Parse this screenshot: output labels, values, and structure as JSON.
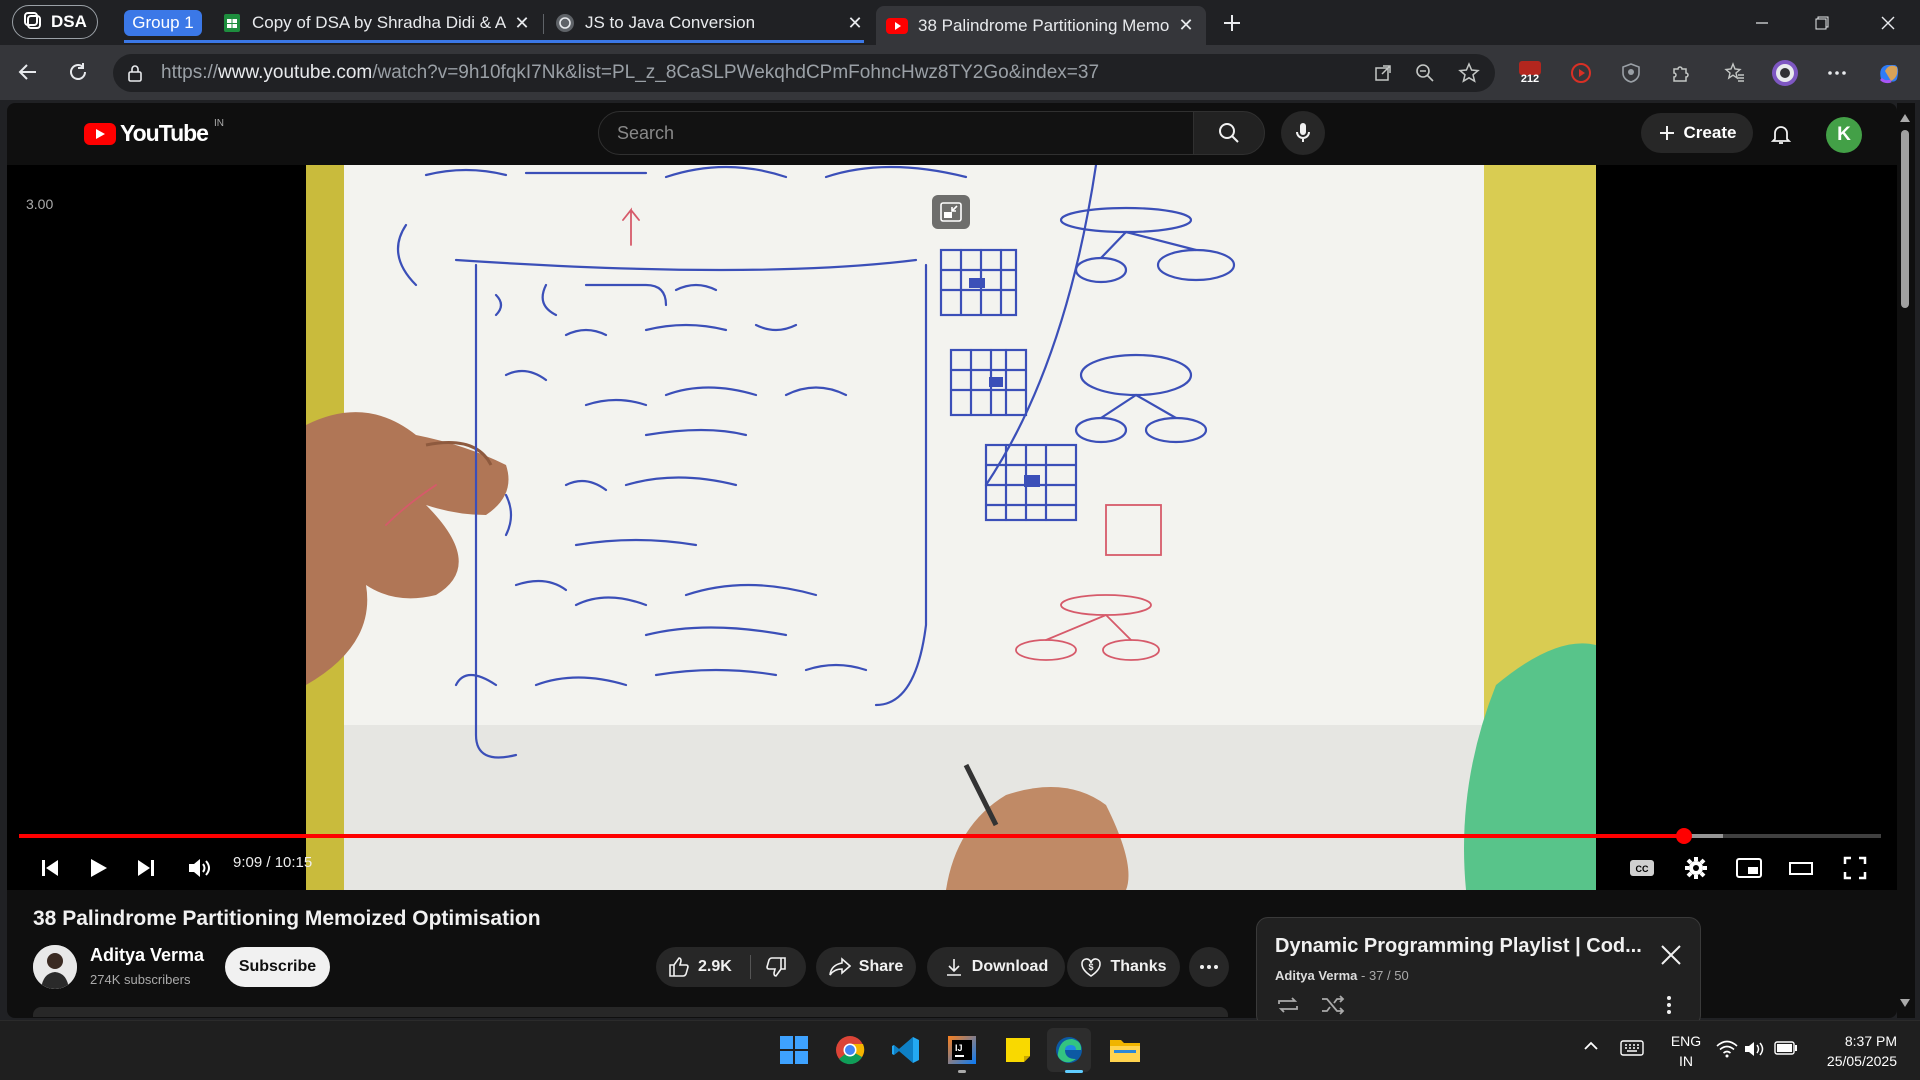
{
  "browser": {
    "profile_label": "DSA",
    "group_label": "Group 1",
    "tabs": [
      {
        "title": "Copy of DSA by Shradha Didi & A",
        "icon": "google-sheets-icon"
      },
      {
        "title": "JS to Java Conversion",
        "icon": "chatgpt-icon"
      },
      {
        "title": "38 Palindrome Partitioning Memo",
        "icon": "youtube-icon",
        "active": true
      }
    ],
    "url_prefix": "https://",
    "url_domain": "www.youtube.com",
    "url_path": "/watch?v=9h10fqkI7Nk&list=PL_z_8CaSLPWekqhdCPmFohncHwz8TY2Go&index=37",
    "extension_badge": "212"
  },
  "youtube": {
    "wordmark": "YouTube",
    "region": "IN",
    "search_placeholder": "Search",
    "create_label": "Create",
    "avatar_letter": "K",
    "player": {
      "speed_label": "3.00",
      "time_current": "9:09",
      "time_total": "10:15",
      "time_display": "9:09 / 10:15",
      "progress_fraction": 0.894,
      "buffered_fraction": 0.915
    },
    "video": {
      "title": "38 Palindrome Partitioning Memoized Optimisation",
      "channel_name": "Aditya Verma",
      "subscribers": "274K subscribers",
      "subscribe_label": "Subscribe",
      "likes": "2.9K",
      "share_label": "Share",
      "download_label": "Download",
      "thanks_label": "Thanks"
    },
    "playlist": {
      "title": "Dynamic Programming Playlist | Cod...",
      "owner": "Aditya Verma",
      "position": "37 / 50"
    }
  },
  "taskbar": {
    "apps": [
      "windows-start-icon",
      "chrome-icon",
      "vscode-icon",
      "intellij-icon",
      "sticky-notes-icon",
      "edge-icon",
      "file-explorer-icon"
    ],
    "lang_top": "ENG",
    "lang_bottom": "IN",
    "time": "8:37 PM",
    "date": "25/05/2025"
  },
  "colors": {
    "youtube_red": "#ff0000",
    "tab_group_blue": "#3b78e7",
    "avatar_green": "#43a047"
  }
}
